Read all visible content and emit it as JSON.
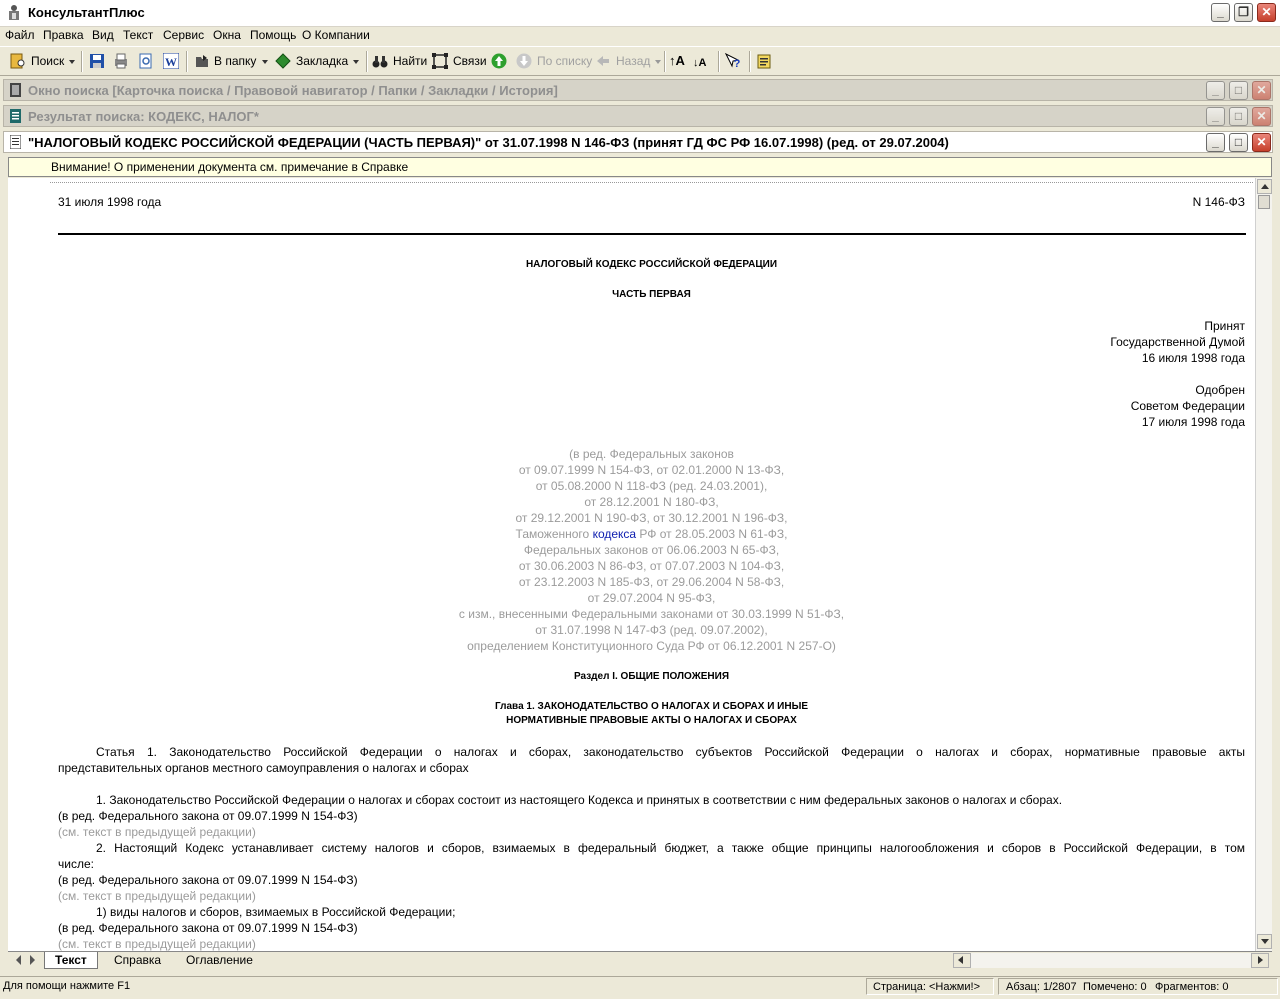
{
  "app": {
    "title": "КонсультантПлюс"
  },
  "menu": [
    "Файл",
    "Правка",
    "Вид",
    "Текст",
    "Сервис",
    "Окна",
    "Помощь",
    "О Компании"
  ],
  "toolbar": {
    "search": "Поиск",
    "to_folder": "В папку",
    "bookmark": "Закладка",
    "find": "Найти",
    "links": "Связи",
    "by_list": "По списку",
    "back": "Назад"
  },
  "windows": {
    "search_window": "Окно поиска [Карточка поиска / Правовой навигатор / Папки / Закладки / История]",
    "search_result": "Результат поиска: КОДЕКС, НАЛОГ*",
    "document": "\"НАЛОГОВЫЙ КОДЕКС РОССИЙСКОЙ ФЕДЕРАЦИИ (ЧАСТЬ ПЕРВАЯ)\" от 31.07.1998 N 146-ФЗ (принят ГД ФС РФ 16.07.1998) (ред. от 29.07.2004)"
  },
  "notice": "Внимание! О применении документа см. примечание в Справке",
  "doc": {
    "date": "31 июля 1998 года",
    "number": "N 146-ФЗ",
    "title": "НАЛОГОВЫЙ КОДЕКС РОССИЙСКОЙ ФЕДЕРАЦИИ",
    "part": "ЧАСТЬ ПЕРВАЯ",
    "accepted": [
      "Принят",
      "Государственной Думой",
      "16 июля 1998 года"
    ],
    "approved": [
      "Одобрен",
      "Советом Федерации",
      "17 июля 1998 года"
    ],
    "editions": [
      "(в ред. Федеральных законов",
      "от 09.07.1999 N 154-ФЗ, от 02.01.2000 N 13-ФЗ,",
      "от 05.08.2000 N 118-ФЗ (ред. 24.03.2001),",
      "от 28.12.2001 N 180-ФЗ,",
      "от 29.12.2001 N 190-ФЗ, от 30.12.2001 N 196-ФЗ,",
      "",
      "Федеральных законов от 06.06.2003 N 65-ФЗ,",
      "от 30.06.2003 N 86-ФЗ, от 07.07.2003 N 104-ФЗ,",
      "от 23.12.2003 N 185-ФЗ, от 29.06.2004 N 58-ФЗ,",
      "от 29.07.2004 N 95-ФЗ,",
      "с изм., внесенными Федеральными законами от 30.03.1999 N 51-ФЗ,",
      "от 31.07.1998 N 147-ФЗ (ред. 09.07.2002),",
      "определением Конституционного Суда РФ от 06.12.2001 N 257-О)"
    ],
    "customs_pre": "Таможенного ",
    "customs_link": "кодекса",
    "customs_post": " РФ от 28.05.2003 N 61-ФЗ,",
    "section": "Раздел I. ОБЩИЕ ПОЛОЖЕНИЯ",
    "chapter1": "Глава 1. ЗАКОНОДАТЕЛЬСТВО О НАЛОГАХ И СБОРАХ И ИНЫЕ",
    "chapter2": "НОРМАТИВНЫЕ ПРАВОВЫЕ АКТЫ О НАЛОГАХ И СБОРАХ",
    "article1_l1": "Статья 1. Законодательство Российской Федерации о налогах и сборах, законодательство субъектов Российской Федерации о налогах и сборах, нормативные правовые акты",
    "article1_l2": "представительных органов местного самоуправления о налогах и сборах",
    "p1": "1. Законодательство Российской Федерации о налогах и сборах состоит из настоящего Кодекса и принятых в соответствии с ним федеральных законов о налогах и сборах.",
    "ed_ref": "(в ред. Федерального закона от 09.07.1999 N 154-ФЗ)",
    "prev_ref": "(см. текст в предыдущей редакции)",
    "p2_l1": "2. Настоящий Кодекс устанавливает систему налогов и сборов, взимаемых в федеральный бюджет, а также общие принципы налогообложения и сборов в Российской Федерации, в том",
    "p2_l2": "числе:",
    "p3": "1) виды налогов и сборов, взимаемых в Российской Федерации;"
  },
  "tabs": [
    "Текст",
    "Справка",
    "Оглавление"
  ],
  "status": {
    "help": "Для помощи нажмите F1",
    "page": "Страница: <Нажми!>",
    "para": "Абзац: 1/2807",
    "marked": "Помечено: 0",
    "fragments": "Фрагментов: 0"
  }
}
